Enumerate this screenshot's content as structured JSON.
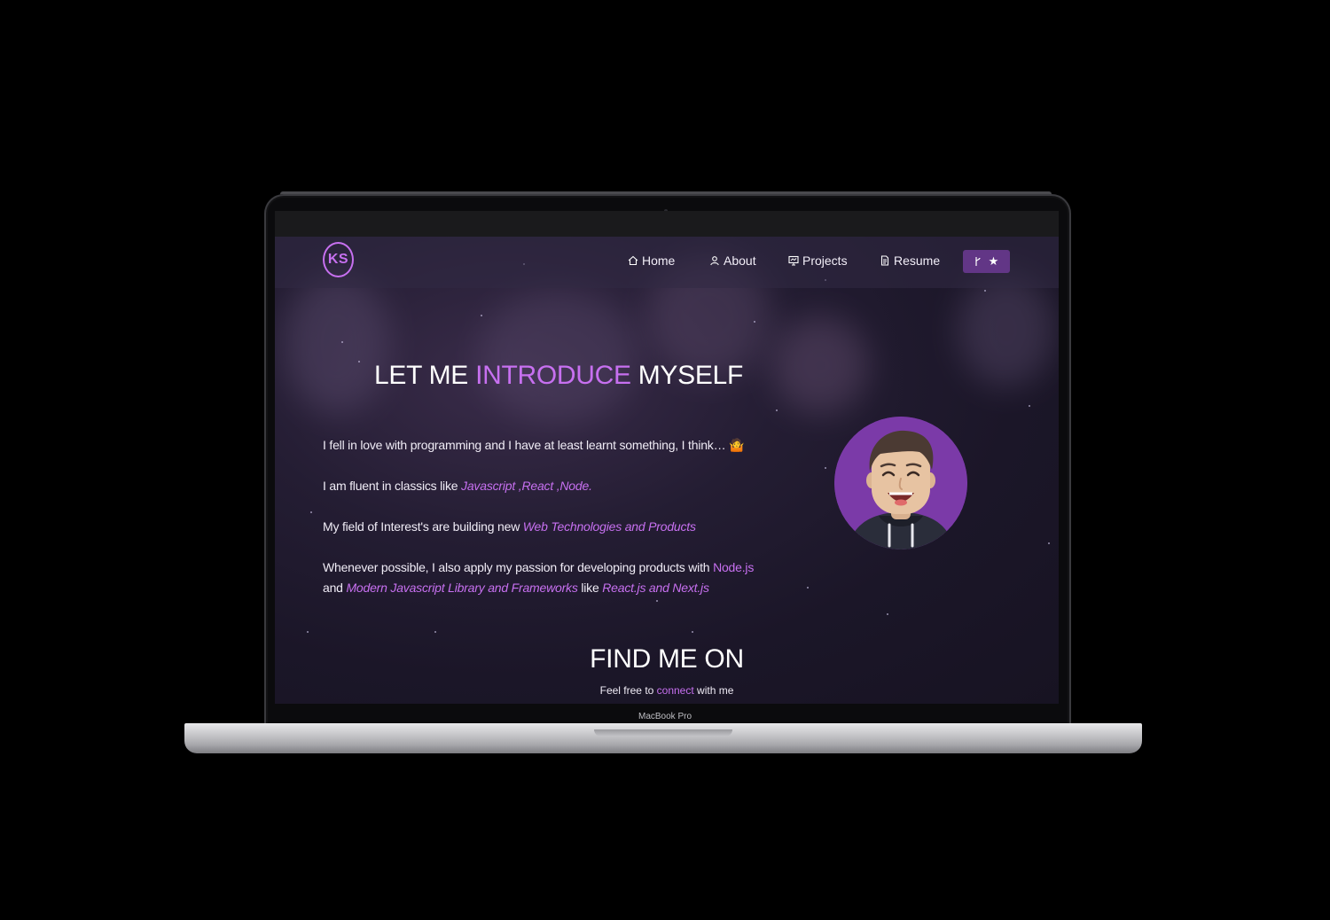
{
  "device": {
    "model_label": "MacBook Pro"
  },
  "navbar": {
    "logo": "KS",
    "items": [
      {
        "label": "Home",
        "icon": "home-icon"
      },
      {
        "label": "About",
        "icon": "user-icon"
      },
      {
        "label": "Projects",
        "icon": "presentation-icon"
      },
      {
        "label": "Resume",
        "icon": "document-icon"
      }
    ],
    "fork_button": {
      "icons": [
        "git-fork-icon",
        "star-icon"
      ]
    }
  },
  "intro": {
    "title_part1": "LET ME ",
    "title_highlight": "INTRODUCE",
    "title_part2": " MYSELF",
    "p1": "I fell in love with programming and I have at least learnt something, I think… 🤷",
    "p2_text": "I am fluent in classics like ",
    "p2_highlight": "Javascript ,React ,Node.",
    "p3_text": "My field of Interest's are building new ",
    "p3_highlight": "Web Technologies and Products",
    "p4_text1": "Whenever possible, I also apply my passion for developing products with ",
    "p4_highlight1": "Node.js",
    "p4_text2": "and ",
    "p4_highlight2": "Modern Javascript Library and Frameworks",
    "p4_text3": " like ",
    "p4_highlight3": "React.js and Next.js"
  },
  "find_me": {
    "title": "FIND ME ON",
    "sub_text1": "Feel free to ",
    "sub_link": "connect",
    "sub_text2": " with me"
  },
  "colors": {
    "accent": "#c770f0",
    "background": "#1b1628",
    "button": "#623686"
  }
}
